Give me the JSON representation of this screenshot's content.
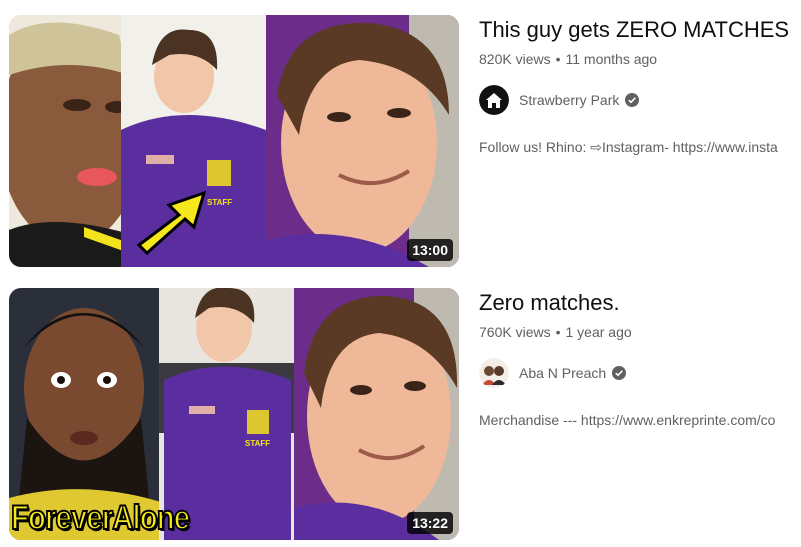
{
  "results": [
    {
      "title": "This guy gets ZERO MATCHES",
      "views": "820K views",
      "separator": "•",
      "age": "11 months ago",
      "channel": "Strawberry Park",
      "verified": true,
      "avatar_icon": "house-icon",
      "description": "Follow us! Rhino: ⇨Instagram- https://www.insta",
      "duration": "13:00",
      "overlay_text": ""
    },
    {
      "title": "Zero matches.",
      "views": "760K views",
      "separator": "•",
      "age": "1 year ago",
      "channel": "Aba N Preach",
      "verified": true,
      "avatar_icon": "two-people-avatar",
      "description": "Merchandise --- https://www.enkreprinte.com/co",
      "duration": "13:22",
      "overlay_text": "ForeverAlone"
    }
  ],
  "colors": {
    "staff_shirt": "#5b2ea0",
    "gym_wall": "#6c2d8a",
    "arrow": "#f7e81d",
    "overlay_text": "#f3ea18",
    "secondary_text": "#606060",
    "verified_badge": "#606060"
  }
}
